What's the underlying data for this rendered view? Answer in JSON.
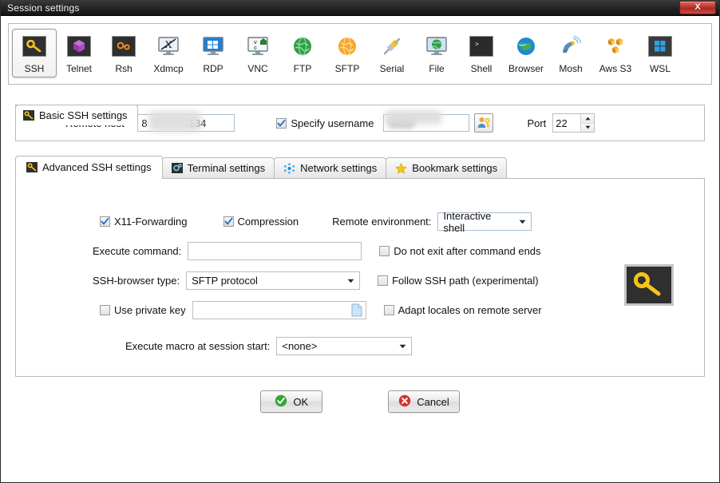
{
  "window": {
    "title": "Session settings",
    "close_label": "X"
  },
  "session_types": [
    {
      "label": "SSH",
      "icon": "ssh-key-icon",
      "selected": true
    },
    {
      "label": "Telnet",
      "icon": "telnet-cube-icon",
      "selected": false
    },
    {
      "label": "Rsh",
      "icon": "rsh-gear-icon",
      "selected": false
    },
    {
      "label": "Xdmcp",
      "icon": "xdmcp-monitor-icon",
      "selected": false
    },
    {
      "label": "RDP",
      "icon": "rdp-monitor-icon",
      "selected": false
    },
    {
      "label": "VNC",
      "icon": "vnc-monitor-icon",
      "selected": false
    },
    {
      "label": "FTP",
      "icon": "ftp-globe-icon",
      "selected": false
    },
    {
      "label": "SFTP",
      "icon": "sftp-globe-icon",
      "selected": false
    },
    {
      "label": "Serial",
      "icon": "serial-plug-icon",
      "selected": false
    },
    {
      "label": "File",
      "icon": "file-monitor-icon",
      "selected": false
    },
    {
      "label": "Shell",
      "icon": "shell-prompt-icon",
      "selected": false
    },
    {
      "label": "Browser",
      "icon": "browser-globe-icon",
      "selected": false
    },
    {
      "label": "Mosh",
      "icon": "mosh-dish-icon",
      "selected": false
    },
    {
      "label": "Aws S3",
      "icon": "aws-s3-icon",
      "selected": false
    },
    {
      "label": "WSL",
      "icon": "wsl-windows-icon",
      "selected": false
    }
  ],
  "basic": {
    "tab_label": "Basic SSH settings",
    "remote_host_label": "Remote host *",
    "remote_host_value_prefix": "8",
    "remote_host_value_suffix": "134",
    "specify_username_label": "Specify username",
    "specify_username_checked": true,
    "username_value": "",
    "port_label": "Port",
    "port_value": "22"
  },
  "tabs": [
    {
      "label": "Advanced SSH settings",
      "icon": "ssh-key-icon",
      "active": true
    },
    {
      "label": "Terminal settings",
      "icon": "gear-icon",
      "active": false
    },
    {
      "label": "Network settings",
      "icon": "network-dots-icon",
      "active": false
    },
    {
      "label": "Bookmark settings",
      "icon": "star-icon",
      "active": false
    }
  ],
  "advanced": {
    "x11_forwarding_label": "X11-Forwarding",
    "x11_forwarding_checked": true,
    "compression_label": "Compression",
    "compression_checked": true,
    "remote_environment_label": "Remote environment:",
    "remote_environment_value": "Interactive shell",
    "execute_command_label": "Execute command:",
    "execute_command_value": "",
    "do_not_exit_label": "Do not exit after command ends",
    "do_not_exit_checked": false,
    "ssh_browser_type_label": "SSH-browser type:",
    "ssh_browser_type_value": "SFTP protocol",
    "follow_ssh_path_label": "Follow SSH path (experimental)",
    "follow_ssh_path_checked": false,
    "use_private_key_label": "Use private key",
    "use_private_key_checked": false,
    "private_key_value": "",
    "adapt_locales_label": "Adapt locales on remote server",
    "adapt_locales_checked": false,
    "execute_macro_label": "Execute macro at session start:",
    "execute_macro_value": "<none>"
  },
  "buttons": {
    "ok_label": "OK",
    "cancel_label": "Cancel"
  },
  "colors": {
    "accent_blue": "#2a6fc9",
    "key_yellow": "#f5c518",
    "ok_green": "#33a532",
    "cancel_red": "#d8322c",
    "title_bar": "#232323"
  }
}
